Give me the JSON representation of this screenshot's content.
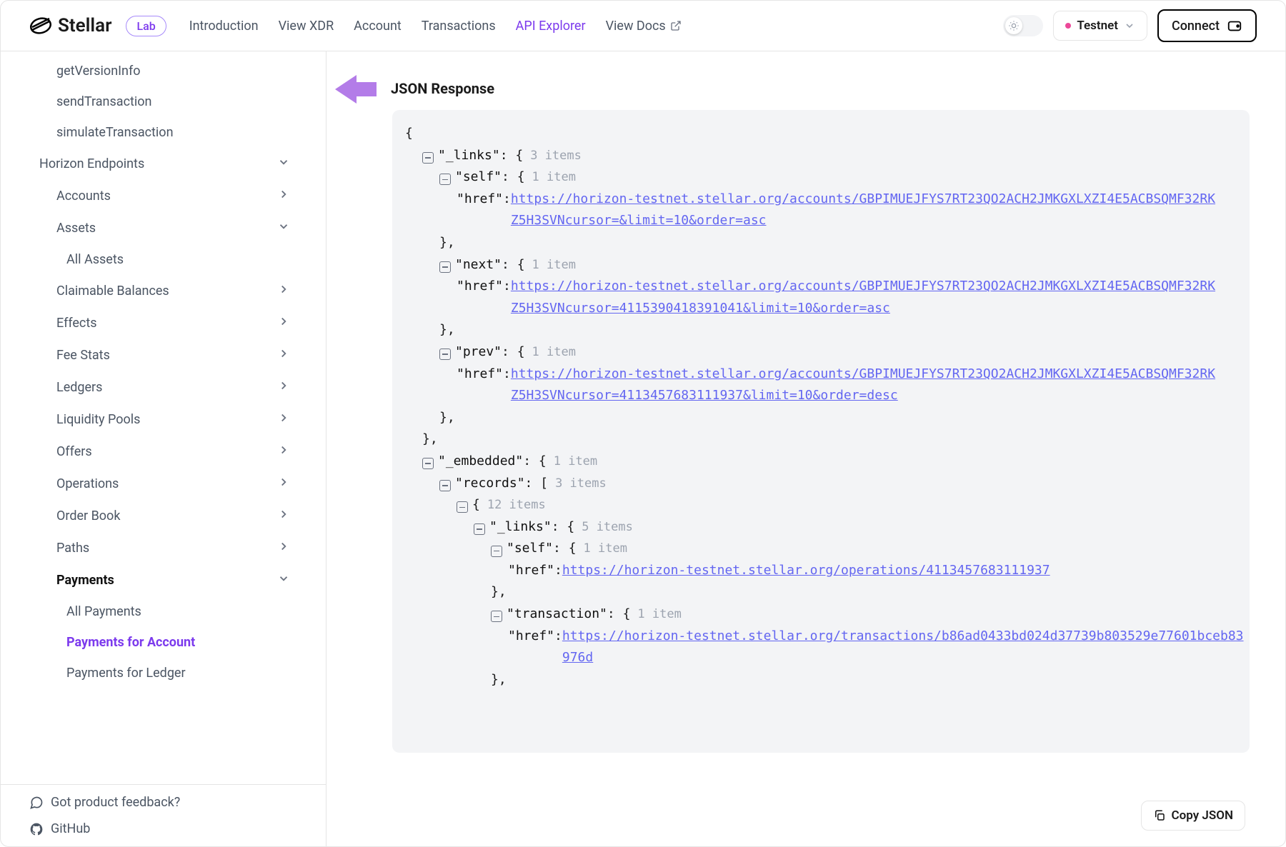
{
  "header": {
    "brand": "Stellar",
    "lab": "Lab",
    "nav": [
      "Introduction",
      "View XDR",
      "Account",
      "Transactions",
      "API Explorer",
      "View Docs"
    ],
    "active_nav_index": 4,
    "network_label": "Testnet",
    "connect_label": "Connect"
  },
  "sidebar": {
    "items": [
      {
        "label": "getVersionInfo",
        "level": 1
      },
      {
        "label": "sendTransaction",
        "level": 1
      },
      {
        "label": "simulateTransaction",
        "level": 1
      },
      {
        "label": "Horizon Endpoints",
        "level": 0,
        "chev": "down"
      },
      {
        "label": "Accounts",
        "level": 1,
        "chev": "right"
      },
      {
        "label": "Assets",
        "level": 1,
        "chev": "down"
      },
      {
        "label": "All Assets",
        "level": 2
      },
      {
        "label": "Claimable Balances",
        "level": 1,
        "chev": "right"
      },
      {
        "label": "Effects",
        "level": 1,
        "chev": "right"
      },
      {
        "label": "Fee Stats",
        "level": 1,
        "chev": "right"
      },
      {
        "label": "Ledgers",
        "level": 1,
        "chev": "right"
      },
      {
        "label": "Liquidity Pools",
        "level": 1,
        "chev": "right"
      },
      {
        "label": "Offers",
        "level": 1,
        "chev": "right"
      },
      {
        "label": "Operations",
        "level": 1,
        "chev": "right"
      },
      {
        "label": "Order Book",
        "level": 1,
        "chev": "right"
      },
      {
        "label": "Paths",
        "level": 1,
        "chev": "right"
      },
      {
        "label": "Payments",
        "level": 1,
        "chev": "down",
        "bold": true
      },
      {
        "label": "All Payments",
        "level": 2
      },
      {
        "label": "Payments for Account",
        "level": 2,
        "active": true
      },
      {
        "label": "Payments for Ledger",
        "level": 2
      }
    ],
    "footer": {
      "feedback": "Got product feedback?",
      "github": "GitHub"
    }
  },
  "main": {
    "section_title": "JSON Response",
    "copy_label": "Copy JSON",
    "json": {
      "lines": [
        {
          "indent": 0,
          "text": "{"
        },
        {
          "indent": 1,
          "toggle": true,
          "key": "\"_links\"",
          "after": ": {",
          "hint": "3 items"
        },
        {
          "indent": 2,
          "toggle": true,
          "key": "\"self\"",
          "after": ": {",
          "hint": "1 item"
        },
        {
          "indent": 3,
          "key": "\"href\"",
          "after": ": ",
          "link": "https://horizon-testnet.stellar.org/accounts/GBPIMUEJFYS7RT23QO2ACH2JMKGXLXZI4E5ACBSQMF32RKZ5H3SVNcursor=&limit=10&order=asc"
        },
        {
          "indent": 2,
          "text": "},"
        },
        {
          "indent": 2,
          "toggle": true,
          "key": "\"next\"",
          "after": ": {",
          "hint": "1 item"
        },
        {
          "indent": 3,
          "key": "\"href\"",
          "after": ": ",
          "link": "https://horizon-testnet.stellar.org/accounts/GBPIMUEJFYS7RT23QO2ACH2JMKGXLXZI4E5ACBSQMF32RKZ5H3SVNcursor=4115390418391041&limit=10&order=asc"
        },
        {
          "indent": 2,
          "text": "},"
        },
        {
          "indent": 2,
          "toggle": true,
          "key": "\"prev\"",
          "after": ": {",
          "hint": "1 item"
        },
        {
          "indent": 3,
          "key": "\"href\"",
          "after": ": ",
          "link": "https://horizon-testnet.stellar.org/accounts/GBPIMUEJFYS7RT23QO2ACH2JMKGXLXZI4E5ACBSQMF32RKZ5H3SVNcursor=4113457683111937&limit=10&order=desc"
        },
        {
          "indent": 2,
          "text": "},"
        },
        {
          "indent": 1,
          "text": "},"
        },
        {
          "indent": 1,
          "toggle": true,
          "key": "\"_embedded\"",
          "after": ": {",
          "hint": "1 item"
        },
        {
          "indent": 2,
          "toggle": true,
          "key": "\"records\"",
          "after": ": [",
          "hint": "3 items"
        },
        {
          "indent": 3,
          "toggle": true,
          "text": "{",
          "hint": "12 items"
        },
        {
          "indent": 4,
          "toggle": true,
          "key": "\"_links\"",
          "after": ": {",
          "hint": "5 items"
        },
        {
          "indent": 5,
          "toggle": true,
          "key": "\"self\"",
          "after": ": {",
          "hint": "1 item"
        },
        {
          "indent": 6,
          "key": "\"href\"",
          "after": ": ",
          "link": "https://horizon-testnet.stellar.org/operations/4113457683111937"
        },
        {
          "indent": 5,
          "text": "},"
        },
        {
          "indent": 5,
          "toggle": true,
          "key": "\"transaction\"",
          "after": ": {",
          "hint": "1 item"
        },
        {
          "indent": 6,
          "key": "\"href\"",
          "after": ": ",
          "link": "https://horizon-testnet.stellar.org/transactions/b86ad0433bd024d37739b803529e77601bceb83976d"
        },
        {
          "indent": 5,
          "text": "},"
        }
      ]
    }
  }
}
